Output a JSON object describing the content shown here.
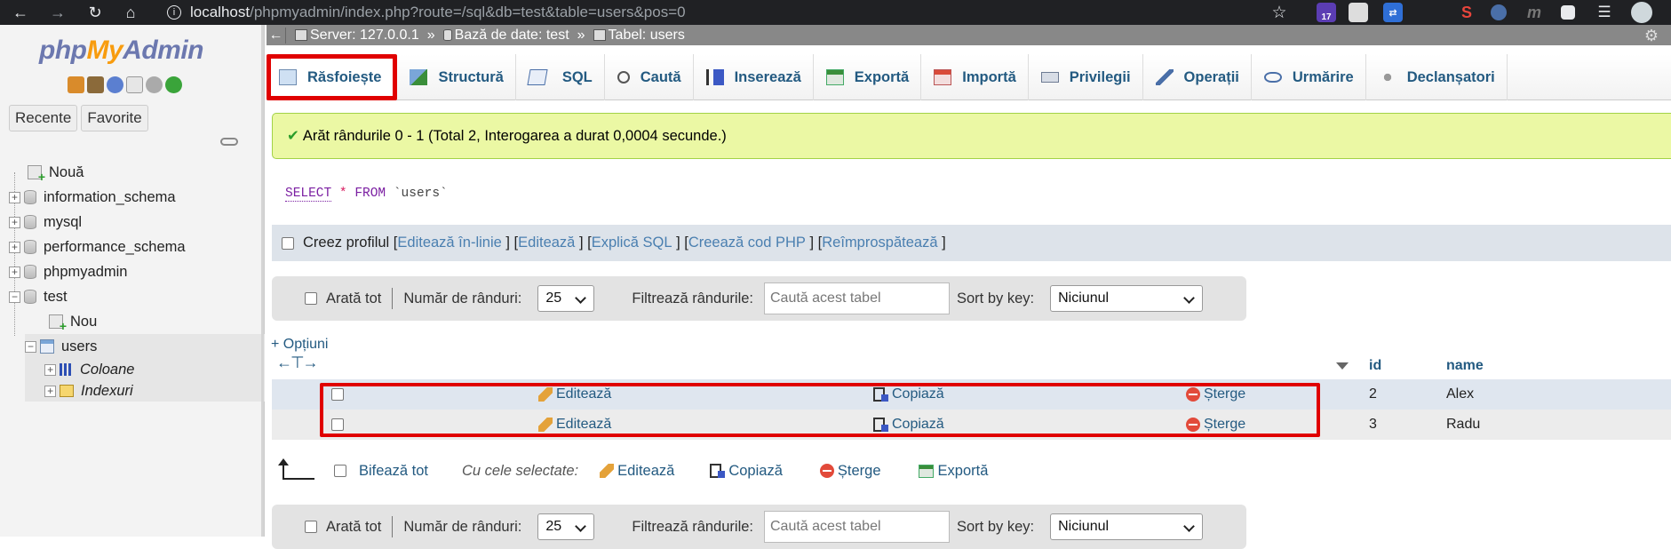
{
  "browser": {
    "url_host": "localhost",
    "url_path": "/phpmyadmin/index.php?route=/sql&db=test&table=users&pos=0",
    "extension_badge": "17"
  },
  "sidebar": {
    "logo": {
      "php": "php",
      "my": "My",
      "admin": "Admin"
    },
    "recent_label": "Recente",
    "favorites_label": "Favorite",
    "tree": {
      "new": "Nouă",
      "dbs": [
        "information_schema",
        "mysql",
        "performance_schema",
        "phpmyadmin",
        "test"
      ],
      "test_new": "Nou",
      "table": "users",
      "columns": "Coloane",
      "indexes": "Indexuri"
    }
  },
  "breadcrumb": {
    "server": "Server: 127.0.0.1",
    "database": "Bază de date: test",
    "table": "Tabel: users",
    "separator": "»"
  },
  "tabs": [
    {
      "label": "Răsfoiește",
      "icon": "browse-icon",
      "active": true
    },
    {
      "label": "Structură",
      "icon": "structure-icon"
    },
    {
      "label": "SQL",
      "icon": "sql-icon"
    },
    {
      "label": "Caută",
      "icon": "search-icon"
    },
    {
      "label": "Inserează",
      "icon": "insert-icon"
    },
    {
      "label": "Exportă",
      "icon": "export-icon"
    },
    {
      "label": "Importă",
      "icon": "import-icon"
    },
    {
      "label": "Privilegii",
      "icon": "privileges-icon"
    },
    {
      "label": "Operații",
      "icon": "operations-icon"
    },
    {
      "label": "Urmărire",
      "icon": "tracking-icon"
    },
    {
      "label": "Declanșatori",
      "icon": "triggers-icon"
    }
  ],
  "success_message": "Arăt rândurile 0 - 1 (Total 2, Interogarea a durat 0,0004 secunde.)",
  "sql": {
    "select": "SELECT",
    "star": "*",
    "from": "FROM",
    "table": "`users`"
  },
  "profile": {
    "label": "Creez profilul",
    "links": [
      "Editează în-linie",
      "Editează",
      "Explică SQL",
      "Creează cod PHP",
      "Reîmprospătează"
    ]
  },
  "nav_panel": {
    "show_all": "Arată tot",
    "rows_label": "Număr de rânduri:",
    "rows_value": "25",
    "filter_label": "Filtrează rândurile:",
    "filter_placeholder": "Caută acest tabel",
    "sort_label": "Sort by key:",
    "sort_value": "Niciunul"
  },
  "options_link": "+ Opțiuni",
  "results": {
    "columns": [
      "id",
      "name"
    ],
    "actions": {
      "edit": "Editează",
      "copy": "Copiază",
      "delete": "Șterge"
    },
    "rows": [
      {
        "id": "2",
        "name": "Alex"
      },
      {
        "id": "3",
        "name": "Radu"
      }
    ]
  },
  "bulk": {
    "check_all": "Bifează tot",
    "with_selected": "Cu cele selectate:",
    "edit": "Editează",
    "copy": "Copiază",
    "delete": "Șterge",
    "export": "Exportă"
  }
}
